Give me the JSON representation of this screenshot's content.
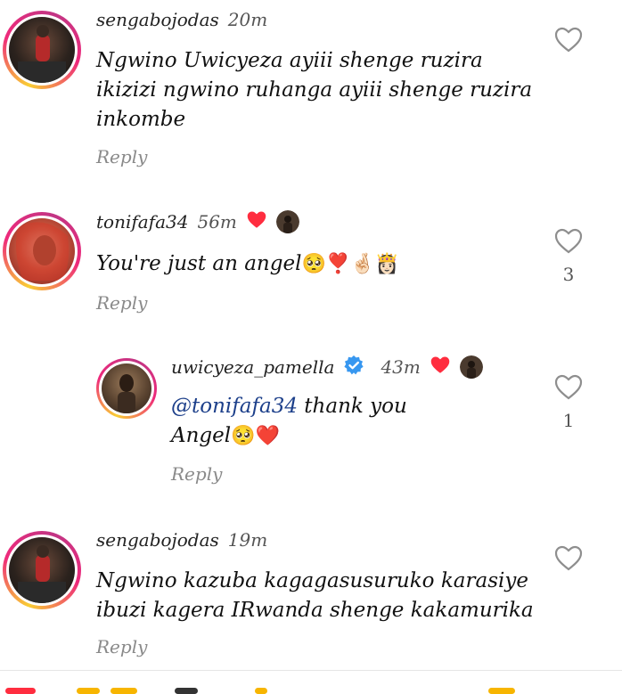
{
  "reply_label": "Reply",
  "comments": [
    {
      "username": "sengabojodas",
      "time": "20m",
      "lines": [
        "Ngwino Uwicyeza ayiii shenge ruzira",
        "ikizizi ngwino ruhanga ayiii shenge ruzira",
        "inkombe"
      ]
    },
    {
      "username": "tonifafa34",
      "time": "56m",
      "text": "You're just an angel",
      "emojis": "🥺❣️🤞🏻👸🏻",
      "likes": "3"
    },
    {
      "username": "uwicyeza_pamella",
      "time": "43m",
      "mention": "@tonifafa34",
      "text_line1": " thank you",
      "text_line2": "Angel",
      "emojis": "🥺❤️",
      "likes": "1"
    },
    {
      "username": "sengabojodas",
      "time": "19m",
      "lines": [
        "Ngwino kazuba kagagasusuruko karasiye",
        "ibuzi kagera IRwanda shenge kakamurika"
      ]
    }
  ],
  "colors": {
    "heart_red": "#ff2d3f",
    "verified_blue": "#3797f0",
    "mention_blue": "#1c3f8a"
  }
}
